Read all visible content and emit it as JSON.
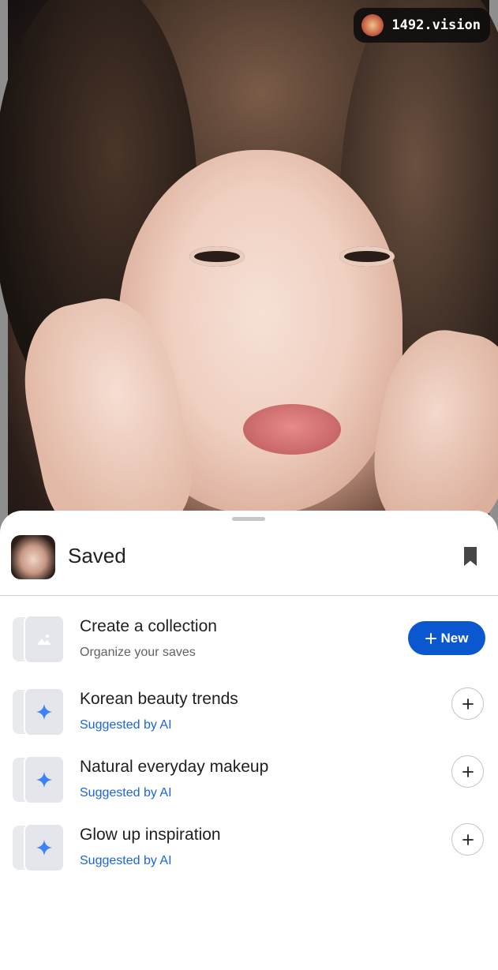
{
  "photo": {
    "watermark_text": "1492.vision"
  },
  "sheet": {
    "title": "Saved",
    "header_icon": "bookmark-icon",
    "create": {
      "title": "Create a collection",
      "subtitle": "Organize your saves",
      "button_label": "New",
      "button_icon": "plus-icon"
    },
    "suggestions": [
      {
        "title": "Korean beauty trends",
        "subtitle": "Suggested by AI",
        "icon": "sparkle-icon",
        "action_icon": "plus-icon"
      },
      {
        "title": "Natural everyday makeup",
        "subtitle": "Suggested by AI",
        "icon": "sparkle-icon",
        "action_icon": "plus-icon"
      },
      {
        "title": "Glow up inspiration",
        "subtitle": "Suggested by AI",
        "icon": "sparkle-icon",
        "action_icon": "plus-icon"
      }
    ]
  },
  "colors": {
    "accent": "#0b57d0",
    "ai_text": "#1a66d6",
    "sparkle": "#3b82f6"
  }
}
